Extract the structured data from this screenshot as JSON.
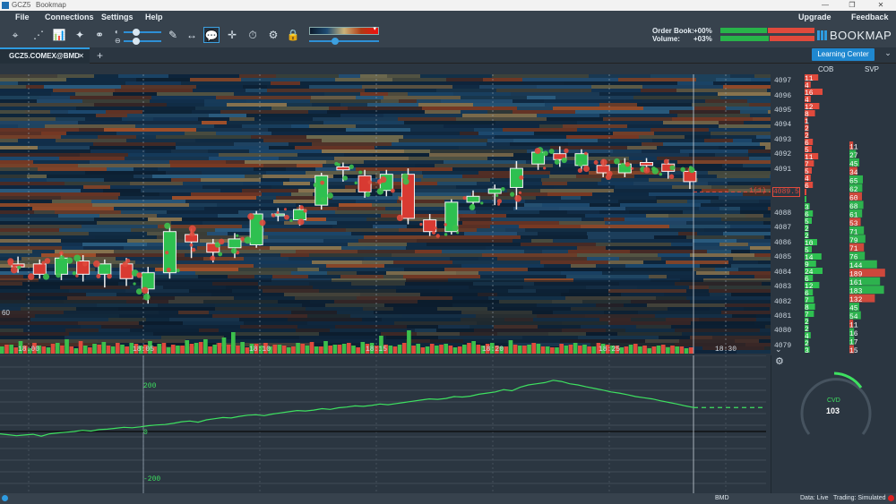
{
  "window": {
    "app_short": "GCZ5",
    "title": "Bookmap",
    "minimize": "—",
    "restore": "❐",
    "close": "✕"
  },
  "menu": {
    "file": "File",
    "connections": "Connections",
    "settings": "Settings",
    "help": "Help",
    "upgrade": "Upgrade",
    "feedback": "Feedback"
  },
  "toolbar_icons": [
    "screenshot-icon",
    "share-icon",
    "indicators-icon",
    "modules-icon",
    "link-icon",
    "pen-icon",
    "ruler-icon",
    "chat-icon",
    "crosshair-icon",
    "timer-icon",
    "alerts-icon",
    "lock-icon"
  ],
  "order_book": {
    "label_ob": "Order Book:",
    "value_ob": "+00%",
    "label_vol": "Volume:",
    "value_vol": "+03%"
  },
  "brand": {
    "name": "BOOKMAP"
  },
  "tab": {
    "label": "GCZ5.COMEX@BMD",
    "close": "✕",
    "add": "+"
  },
  "learning_center": "Learning Center",
  "columns": {
    "cob": "COB",
    "svp": "SVP"
  },
  "colors": {
    "buy": "#3cc04c",
    "sell": "#e04a3c",
    "accent": "#2e9be0",
    "cvd_line": "#3ee060"
  },
  "price_axis": [
    "4097",
    "4096",
    "4095",
    "4094",
    "4093",
    "4092",
    "4091",
    "4089.5",
    "4088",
    "4087",
    "4086",
    "4085",
    "4084",
    "4083",
    "4082",
    "4081",
    "4080",
    "4079"
  ],
  "current_price": {
    "size": "1(1)",
    "price": "4089.5"
  },
  "time_axis": [
    "18:00",
    "18:05",
    "18:10",
    "18:15",
    "18:20",
    "18:25",
    "18:30"
  ],
  "left_edge_label": "60",
  "cob_values": [
    "11",
    "4",
    "16",
    "4",
    "12",
    "8",
    "1",
    "2",
    "2",
    "6",
    "5",
    "11",
    "7",
    "5",
    "4",
    "6",
    "",
    "",
    "3",
    "6",
    "5",
    "2",
    "2",
    "10",
    "5",
    "14",
    "9",
    "24",
    "6",
    "12",
    "6",
    "7",
    "8",
    "7",
    "2",
    "2",
    "4",
    "2",
    "3"
  ],
  "svp_values": [
    "11",
    "27",
    "45",
    "34",
    "65",
    "62",
    "60",
    "68",
    "61",
    "53",
    "71",
    "79",
    "71",
    "76",
    "144",
    "189",
    "161",
    "183",
    "132",
    "45",
    "54",
    "11",
    "16",
    "17",
    "15"
  ],
  "lower_axis": [
    "200",
    "0",
    "-200"
  ],
  "cvd": {
    "label": "CVD",
    "value": "103"
  },
  "status": {
    "instrument": "BMD",
    "data": "Data: Live",
    "trading": "Trading: Simulated"
  },
  "chart_data": {
    "type": "candlestick",
    "ylim": [
      4078.5,
      4097.5
    ],
    "x_ticks": [
      "18:00",
      "18:05",
      "18:10",
      "18:15",
      "18:20",
      "18:25",
      "18:30"
    ],
    "candles": [
      {
        "o": 4084.6,
        "c": 4084.4,
        "h": 4085.1,
        "l": 4084.0
      },
      {
        "o": 4084.6,
        "c": 4083.9,
        "h": 4084.9,
        "l": 4083.6
      },
      {
        "o": 4083.9,
        "c": 4085.0,
        "h": 4085.4,
        "l": 4083.5
      },
      {
        "o": 4084.8,
        "c": 4083.9,
        "h": 4085.2,
        "l": 4083.4
      },
      {
        "o": 4083.9,
        "c": 4084.6,
        "h": 4084.9,
        "l": 4083.0
      },
      {
        "o": 4084.6,
        "c": 4083.6,
        "h": 4085.0,
        "l": 4083.1
      },
      {
        "o": 4082.9,
        "c": 4084.0,
        "h": 4084.4,
        "l": 4081.9
      },
      {
        "o": 4084.0,
        "c": 4086.8,
        "h": 4087.2,
        "l": 4083.6
      },
      {
        "o": 4086.6,
        "c": 4086.1,
        "h": 4087.0,
        "l": 4085.0
      },
      {
        "o": 4086.0,
        "c": 4085.4,
        "h": 4086.3,
        "l": 4084.7
      },
      {
        "o": 4085.7,
        "c": 4086.3,
        "h": 4086.7,
        "l": 4085.0
      },
      {
        "o": 4085.9,
        "c": 4088.0,
        "h": 4088.2,
        "l": 4085.7
      },
      {
        "o": 4088.0,
        "c": 4088.0,
        "h": 4088.4,
        "l": 4087.5
      },
      {
        "o": 4087.6,
        "c": 4088.3,
        "h": 4088.6,
        "l": 4087.2
      },
      {
        "o": 4088.6,
        "c": 4090.6,
        "h": 4090.8,
        "l": 4088.3
      },
      {
        "o": 4091.2,
        "c": 4091.0,
        "h": 4091.5,
        "l": 4090.2
      },
      {
        "o": 4090.6,
        "c": 4089.5,
        "h": 4091.0,
        "l": 4089.1
      },
      {
        "o": 4089.6,
        "c": 4090.7,
        "h": 4091.0,
        "l": 4089.2
      },
      {
        "o": 4090.7,
        "c": 4087.7,
        "h": 4091.1,
        "l": 4087.3
      },
      {
        "o": 4087.6,
        "c": 4086.8,
        "h": 4088.0,
        "l": 4086.5
      },
      {
        "o": 4086.8,
        "c": 4088.8,
        "h": 4089.0,
        "l": 4086.6
      },
      {
        "o": 4088.8,
        "c": 4089.2,
        "h": 4089.6,
        "l": 4088.3
      },
      {
        "o": 4089.4,
        "c": 4089.7,
        "h": 4090.0,
        "l": 4088.6
      },
      {
        "o": 4089.8,
        "c": 4091.1,
        "h": 4091.6,
        "l": 4088.3
      },
      {
        "o": 4091.4,
        "c": 4092.2,
        "h": 4092.5,
        "l": 4091.0
      },
      {
        "o": 4092.1,
        "c": 4091.7,
        "h": 4092.6,
        "l": 4091.2
      },
      {
        "o": 4091.3,
        "c": 4092.1,
        "h": 4092.4,
        "l": 4090.9
      },
      {
        "o": 4091.3,
        "c": 4090.8,
        "h": 4091.7,
        "l": 4090.5
      },
      {
        "o": 4090.8,
        "c": 4091.4,
        "h": 4091.8,
        "l": 4090.5
      },
      {
        "o": 4091.5,
        "c": 4091.3,
        "h": 4091.8,
        "l": 4090.9
      },
      {
        "o": 4091.4,
        "c": 4090.9,
        "h": 4091.7,
        "l": 4090.4
      },
      {
        "o": 4090.9,
        "c": 4090.2,
        "h": 4091.2,
        "l": 4089.7
      }
    ],
    "volume": {
      "buy": [
        8,
        10,
        14,
        6,
        9,
        7,
        12,
        16,
        6,
        9,
        11,
        13,
        8,
        10,
        12,
        9,
        14,
        11,
        7,
        9,
        15,
        12,
        16,
        10,
        18,
        24,
        13,
        11,
        9,
        8,
        10,
        7,
        12,
        9,
        8,
        14,
        10,
        11,
        9,
        13,
        12,
        20,
        9,
        10,
        26,
        11,
        8,
        9,
        11,
        7,
        10,
        14,
        9,
        12,
        8,
        15,
        9,
        10,
        11,
        8,
        7,
        9,
        12,
        10,
        8,
        11,
        9,
        7,
        10,
        8,
        6,
        9,
        7,
        8,
        6
      ],
      "sell": [
        10,
        7,
        9,
        12,
        8,
        11,
        9,
        8,
        14,
        7,
        10,
        9,
        12,
        8,
        11,
        10,
        8,
        12,
        10,
        9,
        11,
        13,
        8,
        12,
        10,
        9,
        7,
        11,
        12,
        10,
        9,
        8,
        11,
        13,
        8,
        9,
        10,
        12,
        7,
        11,
        9,
        10,
        8,
        12,
        9,
        7,
        11,
        10,
        9,
        8,
        12,
        10,
        11,
        9,
        8,
        10,
        9,
        12,
        8,
        7,
        11,
        10,
        9,
        8,
        12,
        10,
        9,
        8,
        11,
        9,
        8,
        10,
        9,
        8,
        7
      ]
    },
    "cvd_series": [
      -10,
      -14,
      -18,
      -15,
      -12,
      -20,
      -10,
      -6,
      -3,
      0,
      5,
      2,
      8,
      10,
      14,
      18,
      16,
      20,
      25,
      28,
      30,
      35,
      42,
      45,
      40,
      50,
      55,
      60,
      58,
      65,
      70,
      72,
      68,
      75,
      80,
      85,
      90,
      88,
      92,
      98,
      95,
      102,
      105,
      110,
      108,
      112,
      118,
      115,
      120,
      125,
      130,
      135,
      140,
      138,
      142,
      150,
      148,
      152,
      160,
      165,
      170,
      180,
      175,
      190,
      200,
      205,
      210,
      220,
      215,
      205,
      200,
      192,
      185,
      178,
      170,
      165,
      158,
      150,
      145,
      140,
      132,
      125,
      118,
      110,
      103
    ],
    "cvd_axis_ticks": [
      200,
      0,
      -200
    ]
  }
}
